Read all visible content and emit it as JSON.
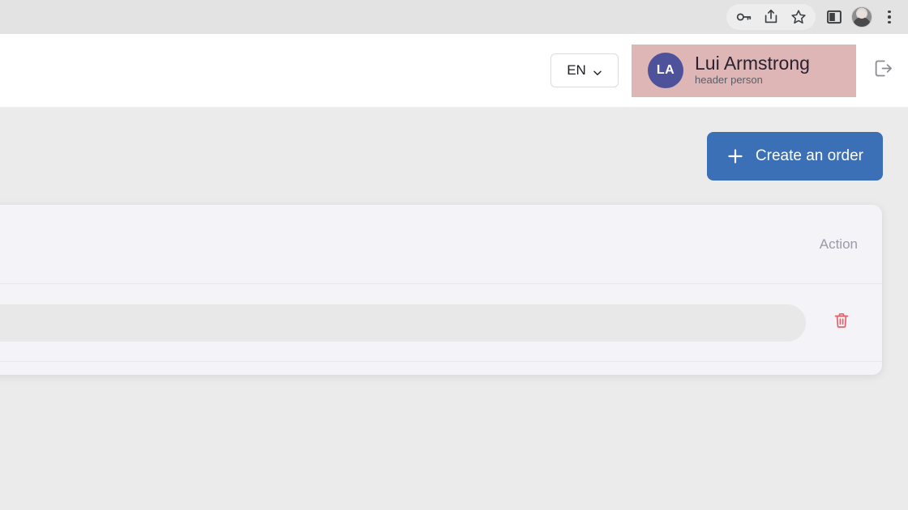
{
  "browser": {
    "toolbar_icons": [
      {
        "name": "password-key-icon",
        "label": "Passwords"
      },
      {
        "name": "share-icon",
        "label": "Share"
      },
      {
        "name": "bookmark-star-icon",
        "label": "Bookmark this tab"
      }
    ],
    "side_panel": {
      "name": "side-panel-icon",
      "label": "Side panel"
    },
    "profile": {
      "name": "profile-avatar",
      "label": "Profile"
    },
    "menu": {
      "name": "three-dot-menu-icon",
      "label": "Customize and control"
    }
  },
  "header": {
    "language": {
      "value": "EN",
      "chevron": "chevron-down-icon",
      "options": [
        "EN"
      ]
    },
    "user": {
      "initials": "LA",
      "name": "Lui Armstrong",
      "role": "header person",
      "highlight_color": "#deb6b6",
      "avatar_color": "#4d529b"
    },
    "logout": {
      "icon": "logout-icon",
      "label": "Log out"
    }
  },
  "toolbar": {
    "create_order_label": "Create an order",
    "create_order_icon": "plus-icon",
    "accent_color": "#3b6fb6"
  },
  "table": {
    "columns": [
      {
        "key": "action",
        "label": "Action"
      }
    ],
    "rows": [
      {
        "content": "",
        "loading": true,
        "delete_icon": "trash-icon",
        "delete_label": "Delete"
      }
    ],
    "card_background": "#f4f3f8",
    "skeleton_color": "#e8e8e8",
    "delete_color": "#e2636d"
  },
  "page": {
    "background_color": "#ebebeb"
  }
}
